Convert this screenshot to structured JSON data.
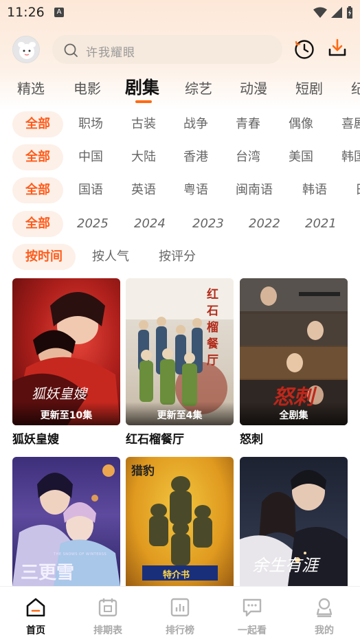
{
  "status_bar": {
    "time": "11:26",
    "notif_glyph": "A"
  },
  "search": {
    "placeholder": "许我耀眼"
  },
  "icons": {
    "history": "clock-icon",
    "download": "download-icon",
    "search": "search-icon"
  },
  "colors": {
    "accent": "#ff6a13",
    "chip_selected_bg": "#fdf0e8",
    "chip_selected_text": "#ff5b1a"
  },
  "tabs": [
    {
      "label": "精选"
    },
    {
      "label": "电影"
    },
    {
      "label": "剧集",
      "active": true
    },
    {
      "label": "综艺"
    },
    {
      "label": "动漫"
    },
    {
      "label": "短剧"
    },
    {
      "label": "纪"
    }
  ],
  "filters": {
    "genre": [
      "全部",
      "职场",
      "古装",
      "战争",
      "青春",
      "偶像",
      "喜剧"
    ],
    "region": [
      "全部",
      "中国",
      "大陆",
      "香港",
      "台湾",
      "美国",
      "韩国"
    ],
    "language": [
      "全部",
      "国语",
      "英语",
      "粤语",
      "闽南语",
      "韩语",
      "日"
    ],
    "year": [
      "全部",
      "2025",
      "2024",
      "2023",
      "2022",
      "2021"
    ],
    "sort": [
      "按时间",
      "按人气",
      "按评分"
    ]
  },
  "cards": [
    {
      "title": "狐妖皇嫂",
      "badge": "更新至10集",
      "poster_text": "狐妖皇嫂"
    },
    {
      "title": "红石榴餐厅",
      "badge": "更新至4集",
      "poster_text": "红石榴餐厅"
    },
    {
      "title": "怒刺",
      "badge": "全剧集",
      "poster_text": "怒刺"
    },
    {
      "title": "",
      "badge": "",
      "poster_text": "三更雪",
      "poster_subtext": "THE SNOWS OF WINTERSS"
    },
    {
      "title": "",
      "badge": "",
      "poster_text": "猎豹",
      "poster_subtext": "特介书"
    },
    {
      "title": "",
      "badge": "",
      "poster_text": "余生有涯"
    }
  ],
  "bottom_nav": [
    {
      "label": "首页",
      "icon": "home-icon",
      "active": true
    },
    {
      "label": "排期表",
      "icon": "calendar-icon"
    },
    {
      "label": "排行榜",
      "icon": "chart-icon"
    },
    {
      "label": "一起看",
      "icon": "chat-icon"
    },
    {
      "label": "我的",
      "icon": "profile-icon"
    }
  ]
}
